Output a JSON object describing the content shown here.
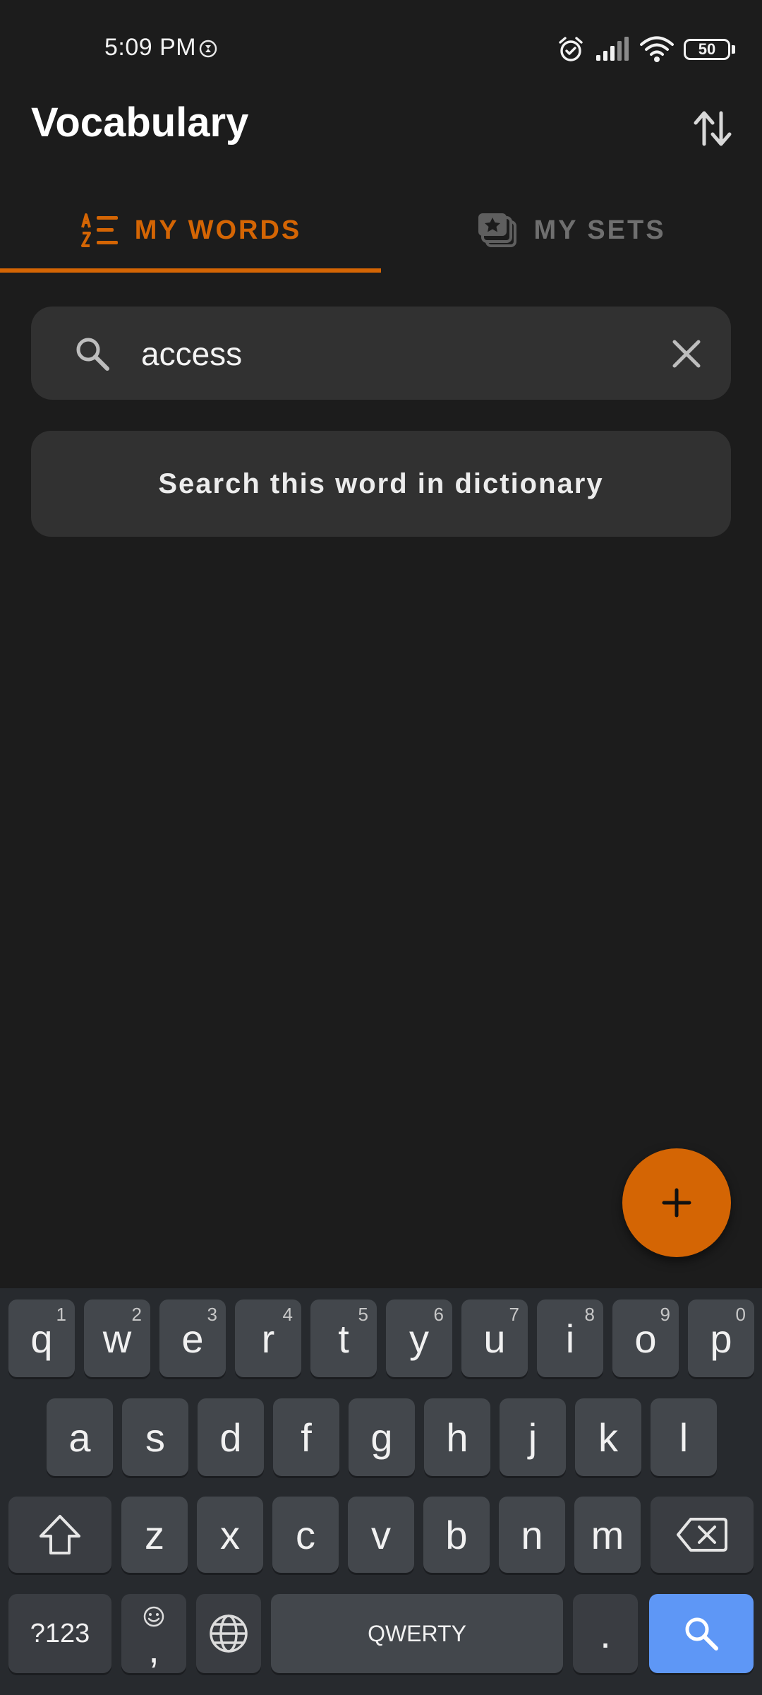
{
  "status_bar": {
    "time": "5:09 PM",
    "battery_level": "50",
    "icons": [
      "dnd-timer-icon",
      "alarm-icon",
      "signal-icon",
      "wifi-icon",
      "battery-icon"
    ]
  },
  "header": {
    "title": "Vocabulary",
    "sort_icon": "sort-arrows-icon"
  },
  "tabs": [
    {
      "label": "MY WORDS",
      "icon": "az-list-icon",
      "active": true
    },
    {
      "label": "MY SETS",
      "icon": "cards-star-icon",
      "active": false
    }
  ],
  "search": {
    "value": "access",
    "placeholder": ""
  },
  "dictionary_button": {
    "label": "Search this word in dictionary"
  },
  "fab": {
    "icon": "plus-icon"
  },
  "keyboard": {
    "row1": [
      {
        "k": "q",
        "h": "1"
      },
      {
        "k": "w",
        "h": "2"
      },
      {
        "k": "e",
        "h": "3"
      },
      {
        "k": "r",
        "h": "4"
      },
      {
        "k": "t",
        "h": "5"
      },
      {
        "k": "y",
        "h": "6"
      },
      {
        "k": "u",
        "h": "7"
      },
      {
        "k": "i",
        "h": "8"
      },
      {
        "k": "o",
        "h": "9"
      },
      {
        "k": "p",
        "h": "0"
      }
    ],
    "row2": [
      "a",
      "s",
      "d",
      "f",
      "g",
      "h",
      "j",
      "k",
      "l"
    ],
    "row3": [
      "z",
      "x",
      "c",
      "v",
      "b",
      "n",
      "m"
    ],
    "symbols_label": "?123",
    "comma_label": ",",
    "space_label": "QWERTY",
    "period_label": "."
  },
  "colors": {
    "accent": "#d46504",
    "background": "#1c1c1c",
    "surface": "#313131",
    "keyboard_bg": "#272a2e",
    "key": "#43474c",
    "enter_key": "#5e97f6"
  }
}
